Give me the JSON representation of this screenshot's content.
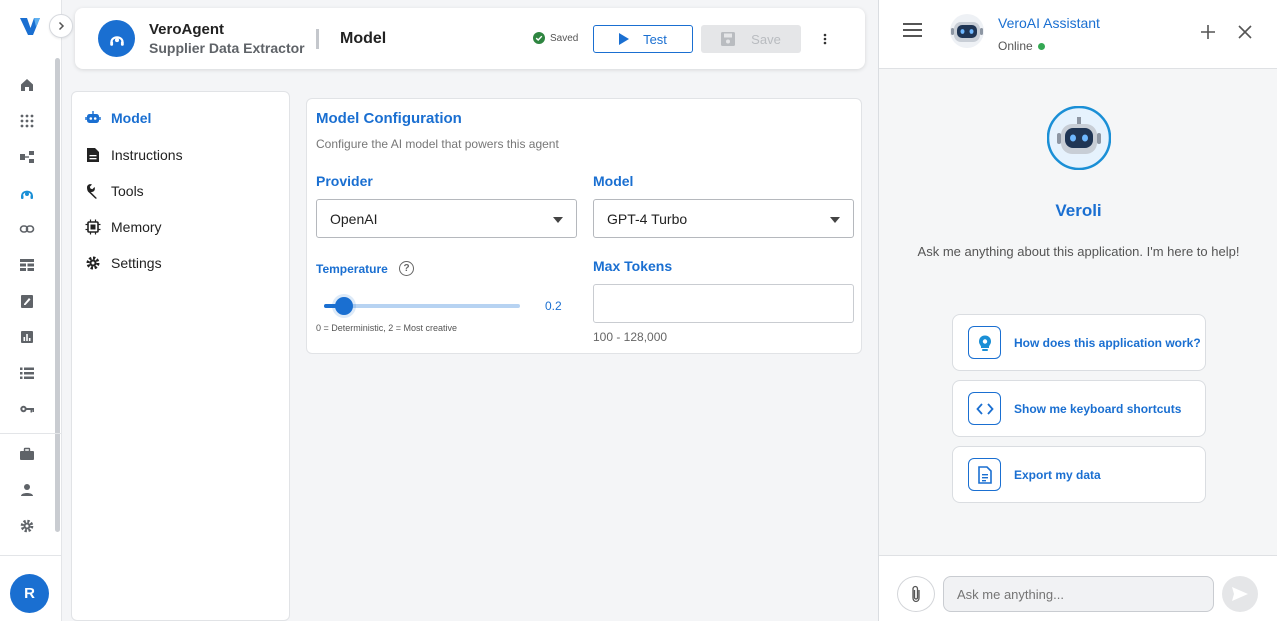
{
  "header": {
    "agent_name": "VeroAgent",
    "agent_subtitle": "Supplier Data Extractor",
    "page_title": "Model",
    "saved_label": "Saved",
    "test_label": "Test",
    "save_label": "Save"
  },
  "sidebar": {
    "avatar_initial": "R",
    "icons": [
      "home-icon",
      "apps-grid-icon",
      "workflow-icon",
      "agent-icon",
      "link-icon",
      "table-icon",
      "edit-note-icon",
      "chart-icon",
      "list-icon",
      "key-icon",
      "briefcase-icon",
      "user-icon",
      "gear-icon"
    ]
  },
  "sections": [
    {
      "label": "Model",
      "icon": "robot-icon",
      "active": true
    },
    {
      "label": "Instructions",
      "icon": "document-icon",
      "active": false
    },
    {
      "label": "Tools",
      "icon": "wrench-icon",
      "active": false
    },
    {
      "label": "Memory",
      "icon": "chip-icon",
      "active": false
    },
    {
      "label": "Settings",
      "icon": "gear-icon",
      "active": false
    }
  ],
  "config": {
    "title": "Model Configuration",
    "subtitle": "Configure the AI model that powers this agent",
    "provider_label": "Provider",
    "provider_value": "OpenAI",
    "model_label": "Model",
    "model_value": "GPT-4 Turbo",
    "temperature_label": "Temperature",
    "temperature_value": "0.2",
    "temperature_min": 0,
    "temperature_max": 2,
    "temperature_hint": "0 = Deterministic, 2 = Most creative",
    "max_tokens_label": "Max Tokens",
    "max_tokens_value": "",
    "max_tokens_hint": "100 - 128,000"
  },
  "assistant": {
    "name": "VeroAI Assistant",
    "status": "Online",
    "bot_title": "Veroli",
    "intro": "Ask me anything about this application. I'm here to help!",
    "suggestions": [
      {
        "label": "How does this application work?",
        "icon": "lightbulb-gear-icon"
      },
      {
        "label": "Show me keyboard shortcuts",
        "icon": "code-brackets-icon"
      },
      {
        "label": "Export my data",
        "icon": "document-export-icon"
      }
    ],
    "input_placeholder": "Ask me anything..."
  },
  "colors": {
    "accent": "#1a6fd1",
    "online": "#34a853",
    "saved": "#2e8540"
  }
}
